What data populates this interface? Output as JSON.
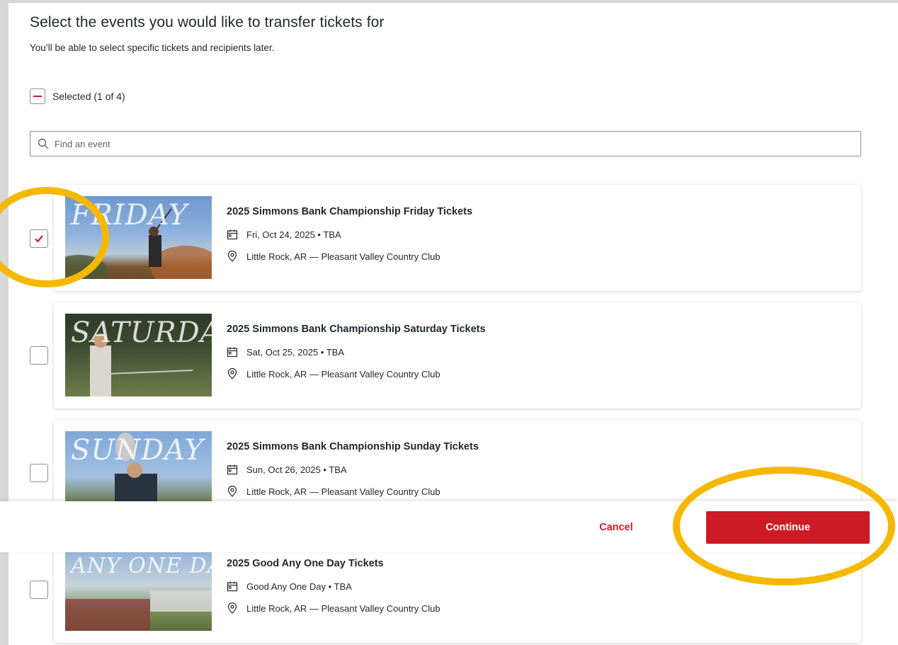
{
  "page": {
    "title": "Select the events you would like to transfer tickets for",
    "subtitle": "You’ll be able to select specific tickets and recipients later."
  },
  "selection": {
    "label": "Selected (1 of 4)"
  },
  "search": {
    "placeholder": "Find an event",
    "icon": "search-icon"
  },
  "events": [
    {
      "title": "2025 Simmons Bank Championship Friday Tickets",
      "thumb_word": "FRIDAY",
      "date": "Fri, Oct 24, 2025 • TBA",
      "location": "Little Rock, AR — Pleasant Valley Country Club",
      "checked": true
    },
    {
      "title": "2025 Simmons Bank Championship Saturday Tickets",
      "thumb_word": "SATURDAY",
      "date": "Sat, Oct 25, 2025 • TBA",
      "location": "Little Rock, AR — Pleasant Valley Country Club",
      "checked": false
    },
    {
      "title": "2025 Simmons Bank Championship Sunday Tickets",
      "thumb_word": "SUNDAY",
      "date": "Sun, Oct 26, 2025 • TBA",
      "location": "Little Rock, AR — Pleasant Valley Country Club",
      "checked": false
    },
    {
      "title": "2025 Good Any One Day Tickets",
      "thumb_word": "ANY ONE DAY",
      "date": "Good Any One Day • TBA",
      "location": "Little Rock, AR — Pleasant Valley Country Club",
      "checked": false
    }
  ],
  "footer": {
    "cancel_label": "Cancel",
    "continue_label": "Continue"
  },
  "colors": {
    "accent": "#cc1b24",
    "highlight": "#f5b800"
  }
}
